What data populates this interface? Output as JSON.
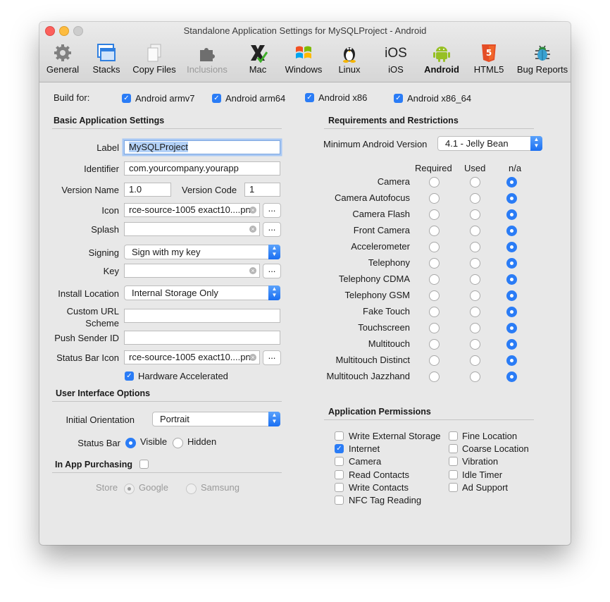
{
  "window": {
    "title": "Standalone Application Settings for MySQLProject - Android"
  },
  "toolbar": [
    {
      "label": "General",
      "icon": "gear-icon",
      "active": false
    },
    {
      "label": "Stacks",
      "icon": "stacks-icon",
      "active": false
    },
    {
      "label": "Copy Files",
      "icon": "copy-files-icon",
      "active": false
    },
    {
      "label": "Inclusions",
      "icon": "puzzle-icon",
      "active": false,
      "disabled": true
    },
    {
      "label": "Mac",
      "icon": "mac-x-icon",
      "active": false
    },
    {
      "label": "Windows",
      "icon": "windows-icon",
      "active": false
    },
    {
      "label": "Linux",
      "icon": "linux-tux-icon",
      "active": false
    },
    {
      "label": "iOS",
      "icon": "ios-icon",
      "active": false
    },
    {
      "label": "Android",
      "icon": "android-icon",
      "active": true
    },
    {
      "label": "HTML5",
      "icon": "html5-icon",
      "active": false
    },
    {
      "label": "Bug Reports",
      "icon": "bug-icon",
      "active": false
    }
  ],
  "build_for": {
    "label": "Build for:",
    "options": [
      {
        "label": "Android armv7",
        "checked": true
      },
      {
        "label": "Android arm64",
        "checked": true
      },
      {
        "label": "Android x86",
        "checked": true
      },
      {
        "label": "Android x86_64",
        "checked": true
      }
    ]
  },
  "basic": {
    "heading": "Basic Application Settings",
    "label_label": "Label",
    "label_value": "MySQLProject",
    "identifier_label": "Identifier",
    "identifier_value": "com.yourcompany.yourapp",
    "version_name_label": "Version Name",
    "version_name_value": "1.0",
    "version_code_label": "Version Code",
    "version_code_value": "1",
    "icon_label": "Icon",
    "icon_value": "rce-source-1005 exact10....pn",
    "splash_label": "Splash",
    "splash_value": "",
    "browse": "...",
    "signing_label": "Signing",
    "signing_value": "Sign with my key",
    "key_label": "Key",
    "key_value": "",
    "install_label": "Install Location",
    "install_value": "Internal Storage Only",
    "url_label_1": "Custom URL",
    "url_label_2": "Scheme",
    "url_value": "",
    "push_label": "Push Sender ID",
    "push_value": "",
    "status_icon_label": "Status Bar Icon",
    "status_icon_value": "rce-source-1005 exact10....pn",
    "hw_label": "Hardware Accelerated",
    "hw_checked": true
  },
  "ui": {
    "heading": "User Interface Options",
    "orientation_label": "Initial Orientation",
    "orientation_value": "Portrait",
    "status_bar_label": "Status Bar",
    "visible_label": "Visible",
    "hidden_label": "Hidden",
    "status_bar_value": "Visible"
  },
  "iap": {
    "heading": "In App Purchasing",
    "checked": false,
    "store_label": "Store",
    "google_label": "Google",
    "samsung_label": "Samsung",
    "store_value": "Google"
  },
  "requirements": {
    "heading": "Requirements and Restrictions",
    "min_version_label": "Minimum Android Version",
    "min_version_value": "4.1 - Jelly Bean",
    "columns": [
      "Required",
      "Used",
      "n/a"
    ],
    "rows": [
      {
        "label": "Camera",
        "value": "n/a"
      },
      {
        "label": "Camera Autofocus",
        "value": "n/a"
      },
      {
        "label": "Camera Flash",
        "value": "n/a"
      },
      {
        "label": "Front Camera",
        "value": "n/a"
      },
      {
        "label": "Accelerometer",
        "value": "n/a"
      },
      {
        "label": "Telephony",
        "value": "n/a"
      },
      {
        "label": "Telephony CDMA",
        "value": "n/a"
      },
      {
        "label": "Telephony GSM",
        "value": "n/a"
      },
      {
        "label": "Fake Touch",
        "value": "n/a"
      },
      {
        "label": "Touchscreen",
        "value": "n/a"
      },
      {
        "label": "Multitouch",
        "value": "n/a"
      },
      {
        "label": "Multitouch Distinct",
        "value": "n/a"
      },
      {
        "label": "Multitouch Jazzhand",
        "value": "n/a"
      }
    ]
  },
  "permissions": {
    "heading": "Application Permissions",
    "left": [
      {
        "label": "Write External Storage",
        "checked": false
      },
      {
        "label": "Internet",
        "checked": true
      },
      {
        "label": "Camera",
        "checked": false
      },
      {
        "label": "Read Contacts",
        "checked": false
      },
      {
        "label": "Write Contacts",
        "checked": false
      },
      {
        "label": "NFC Tag Reading",
        "checked": false
      }
    ],
    "right": [
      {
        "label": "Fine Location",
        "checked": false
      },
      {
        "label": "Coarse Location",
        "checked": false
      },
      {
        "label": "Vibration",
        "checked": false
      },
      {
        "label": "Idle Timer",
        "checked": false
      },
      {
        "label": "Ad Support",
        "checked": false
      }
    ]
  },
  "colors": {
    "accent": "#2a7cf6",
    "android_green": "#97c024",
    "html5_orange": "#e44d26"
  }
}
